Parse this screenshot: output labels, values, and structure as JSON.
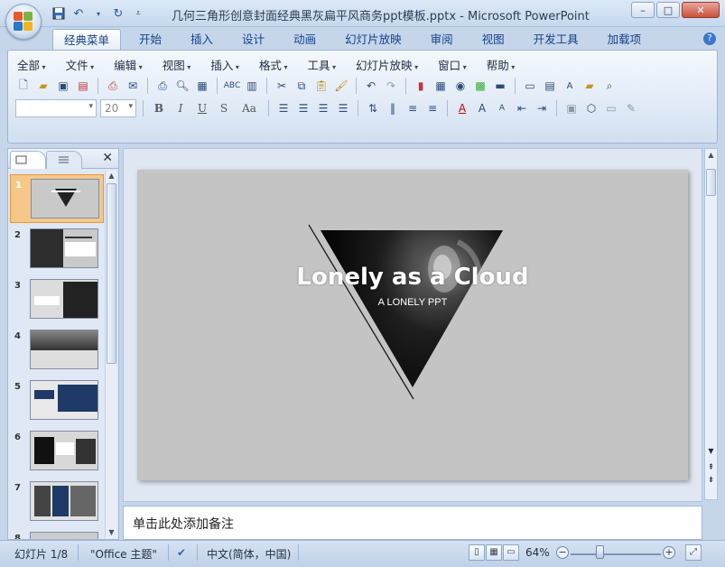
{
  "window": {
    "title": "几何三角形创意封面经典黑灰扁平风商务ppt模板.pptx - Microsoft PowerPoint",
    "controls": [
      "–",
      "□",
      "✕"
    ]
  },
  "ribbon_tabs": [
    "经典菜单",
    "开始",
    "插入",
    "设计",
    "动画",
    "幻灯片放映",
    "审阅",
    "视图",
    "开发工具",
    "加载项"
  ],
  "menu_row": [
    "全部",
    "文件",
    "编辑",
    "视图",
    "插入",
    "格式",
    "工具",
    "幻灯片放映",
    "窗口",
    "帮助"
  ],
  "font_size_value": "20",
  "font_name_value": "",
  "slide_pane": {
    "thumbnails": [
      {
        "num": "1",
        "selected": true
      },
      {
        "num": "2",
        "selected": false
      },
      {
        "num": "3",
        "selected": false
      },
      {
        "num": "4",
        "selected": false
      },
      {
        "num": "5",
        "selected": false
      },
      {
        "num": "6",
        "selected": false
      },
      {
        "num": "7",
        "selected": false
      },
      {
        "num": "8",
        "selected": false
      }
    ]
  },
  "slide": {
    "title": "Lonely as a Cloud",
    "subtitle": "A LONELY PPT",
    "background": "#c4c4c4"
  },
  "notes_placeholder": "单击此处添加备注",
  "status_bar": {
    "slide_counter": "幻灯片 1/8",
    "theme": "\"Office 主题\"",
    "language": "中文(简体，中国)",
    "zoom": "64%",
    "zoom_fraction": 0.64
  },
  "colors": {
    "accent_selected": "#f5c88a",
    "ribbon_text": "#15428b"
  }
}
